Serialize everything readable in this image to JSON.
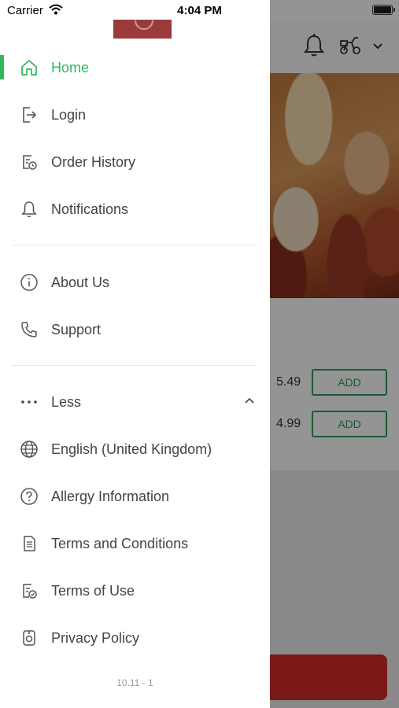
{
  "status_bar": {
    "carrier": "Carrier",
    "time": "4:04 PM"
  },
  "menu": {
    "primary": [
      {
        "label": "Home",
        "icon": "home-icon",
        "active": true
      },
      {
        "label": "Login",
        "icon": "login-icon"
      },
      {
        "label": "Order History",
        "icon": "order-history-icon"
      },
      {
        "label": "Notifications",
        "icon": "bell-icon"
      }
    ],
    "secondary": [
      {
        "label": "About Us",
        "icon": "info-icon"
      },
      {
        "label": "Support",
        "icon": "phone-icon"
      }
    ],
    "less_label": "Less",
    "tertiary": [
      {
        "label": "English (United Kingdom)",
        "icon": "globe-icon"
      },
      {
        "label": "Allergy Information",
        "icon": "question-icon"
      },
      {
        "label": "Terms and Conditions",
        "icon": "document-icon"
      },
      {
        "label": "Terms of Use",
        "icon": "document-check-icon"
      },
      {
        "label": "Privacy Policy",
        "icon": "privacy-icon"
      }
    ]
  },
  "version": "10.11 - 1",
  "background": {
    "items": [
      {
        "price": "5.49",
        "add_label": "ADD"
      },
      {
        "price": "4.99",
        "add_label": "ADD"
      }
    ]
  },
  "colors": {
    "accent": "#2eb85c",
    "brand": "#9b3a3a",
    "cart": "#d42a2a"
  }
}
